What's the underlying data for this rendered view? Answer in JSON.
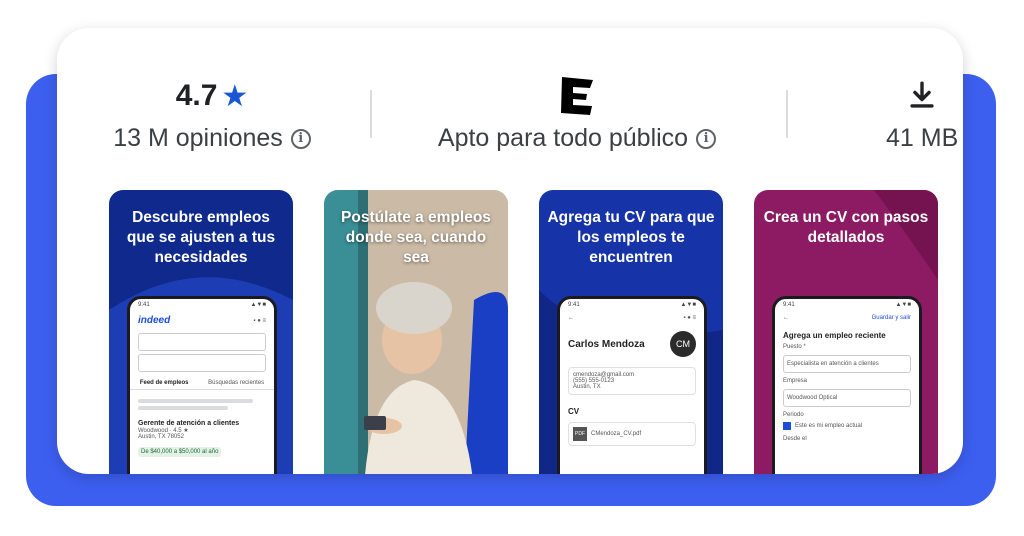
{
  "stats": {
    "rating": {
      "value": "4.7",
      "star_icon": "star-icon",
      "reviews": "13 M opiniones"
    },
    "content_rating": {
      "badge": "E",
      "label": "Apto para todo público"
    },
    "size": {
      "icon": "download-icon",
      "label": "41 MB"
    }
  },
  "screenshots": [
    {
      "caption": "Descubre empleos que se ajusten a tus necesidades",
      "bg": "#0f2a8c",
      "phone": {
        "time": "9:41",
        "brand": "indeed",
        "tab1": "Feed de empleos",
        "tab2": "Búsquedas recientes",
        "job_title": "Gerente de atención a clientes",
        "company": "Woodwood · 4.5 ★",
        "location": "Austin, TX 78052",
        "salary": "De $40,000 a $50,000 al año"
      }
    },
    {
      "caption": "Postúlate a empleos donde sea, cuando sea",
      "bg": "#d7c9b6"
    },
    {
      "caption": "Agrega tu CV para que los empleos te encuentren",
      "bg": "#1733a8",
      "phone": {
        "time": "9:41",
        "name": "Carlos Mendoza",
        "initials": "CM",
        "email": "cmendoza@gmail.com",
        "phone": "(555) 555-0123",
        "city": "Austin, TX",
        "section": "CV",
        "file": "CMendoza_CV.pdf",
        "file_badge": "PDF"
      }
    },
    {
      "caption": "Crea un CV con pasos detallados",
      "bg": "#8c1b63",
      "phone": {
        "time": "9:41",
        "save": "Guardar y salir",
        "heading": "Agrega un empleo reciente",
        "label1": "Puesto *",
        "value1": "Especialista en atención a clientes",
        "label2": "Empresa",
        "value2": "Woodwood Optical",
        "label3": "Periodo",
        "check": "Este es mi empleo actual",
        "label4": "Desde el"
      }
    }
  ]
}
